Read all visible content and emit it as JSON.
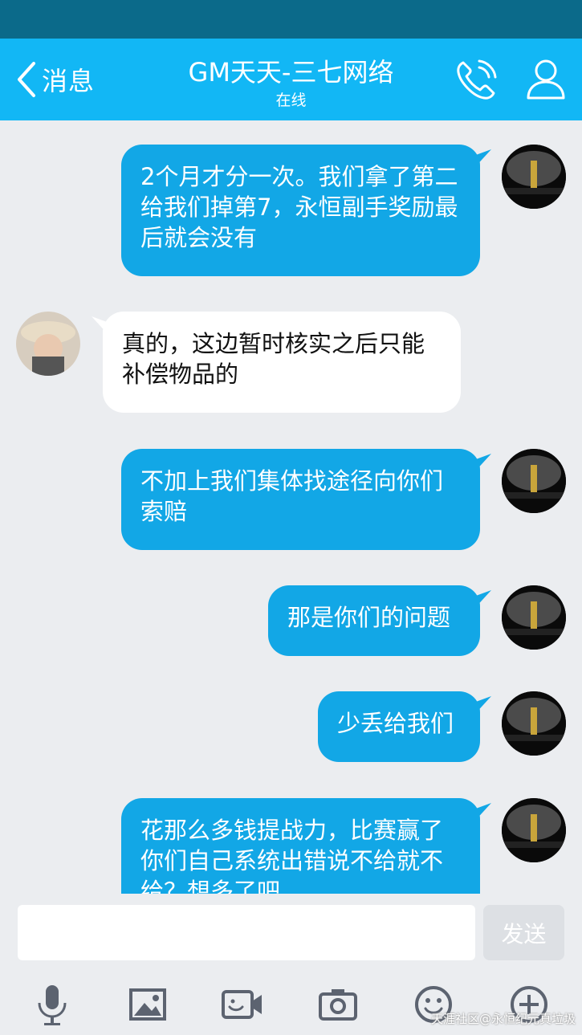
{
  "header": {
    "back_label": "消息",
    "title": "GM天天-三七网络",
    "status": "在线"
  },
  "messages": [
    {
      "sender": "me",
      "text": "2个月才分一次。我们拿了第二给我们掉第7，永恒副手奖励最后就会没有"
    },
    {
      "sender": "other",
      "text": "真的，这边暂时核实之后只能补偿物品的"
    },
    {
      "sender": "me",
      "text": "不加上我们集体找途径向你们索赔"
    },
    {
      "sender": "me",
      "text": "那是你们的问题"
    },
    {
      "sender": "me",
      "text": "少丢给我们"
    },
    {
      "sender": "me",
      "text": "花那么多钱提战力，比赛赢了你们自己系统出错说不给就不给？想多了吧"
    }
  ],
  "composer": {
    "input_value": "",
    "send_label": "发送"
  },
  "toolbar": {
    "icons": [
      "microphone-icon",
      "image-icon",
      "video-call-icon",
      "camera-icon",
      "emoji-icon",
      "plus-icon"
    ]
  },
  "watermark": "天涯社区@永恒纪元真垃圾",
  "colors": {
    "header": "#12b7f5",
    "status_bar": "#0b6a8a",
    "outgoing_bubble": "#12a7e6",
    "incoming_bubble": "#ffffff",
    "background": "#ebedf0"
  }
}
